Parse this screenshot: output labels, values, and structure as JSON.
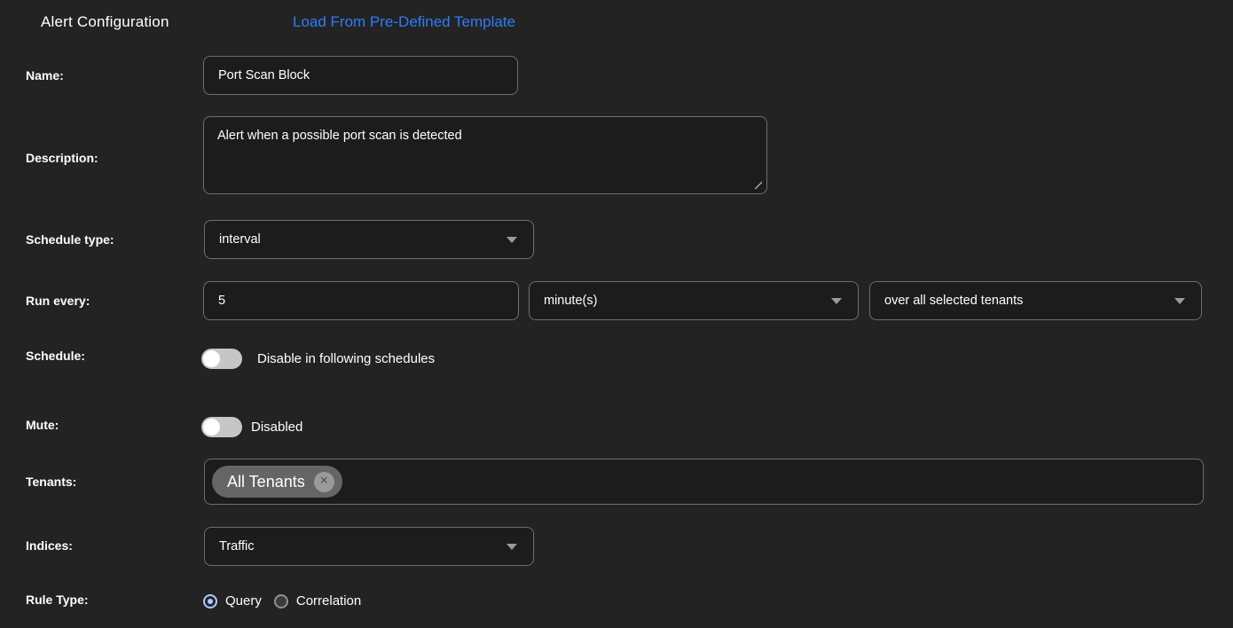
{
  "page": {
    "title": "Alert Configuration",
    "template_link_label": "Load From Pre-Defined Template"
  },
  "icons": {
    "close": "×"
  },
  "colors": {
    "page-bg": "#232323",
    "field-bg": "#1c1c1c",
    "field-border": "#6e6e6e",
    "text": "#ffffff",
    "link-blue": "#2e7cf7",
    "caret-gray": "#9b9b9b",
    "toggle-track": "#c6c6c6",
    "toggle-knob": "#ffffff",
    "chip-bg": "#656565",
    "chip-close-bg": "#9a9a9a",
    "radio-accent": "#aecbfa"
  },
  "fields": {
    "name": {
      "label": "Name:",
      "value": "Port Scan Block"
    },
    "description": {
      "label": "Description:",
      "value": "Alert when a possible port scan is detected"
    },
    "schedule_type": {
      "label": "Schedule type:",
      "value": "interval"
    },
    "run_every": {
      "label": "Run every:",
      "value": "5",
      "unit_value": "minute(s)",
      "scope_value": "over all selected tenants"
    },
    "schedule": {
      "label": "Schedule:",
      "toggle_label": "Disable in following schedules",
      "enabled": false
    },
    "mute": {
      "label": "Mute:",
      "toggle_label": "Disabled",
      "enabled": false
    },
    "tenants": {
      "label": "Tenants:",
      "tags": [
        {
          "label": "All Tenants"
        }
      ]
    },
    "indices": {
      "label": "Indices:",
      "value": "Traffic"
    },
    "rule_type": {
      "label": "Rule Type:",
      "options": [
        {
          "label": "Query",
          "selected": true
        },
        {
          "label": "Correlation",
          "selected": false
        }
      ]
    }
  }
}
